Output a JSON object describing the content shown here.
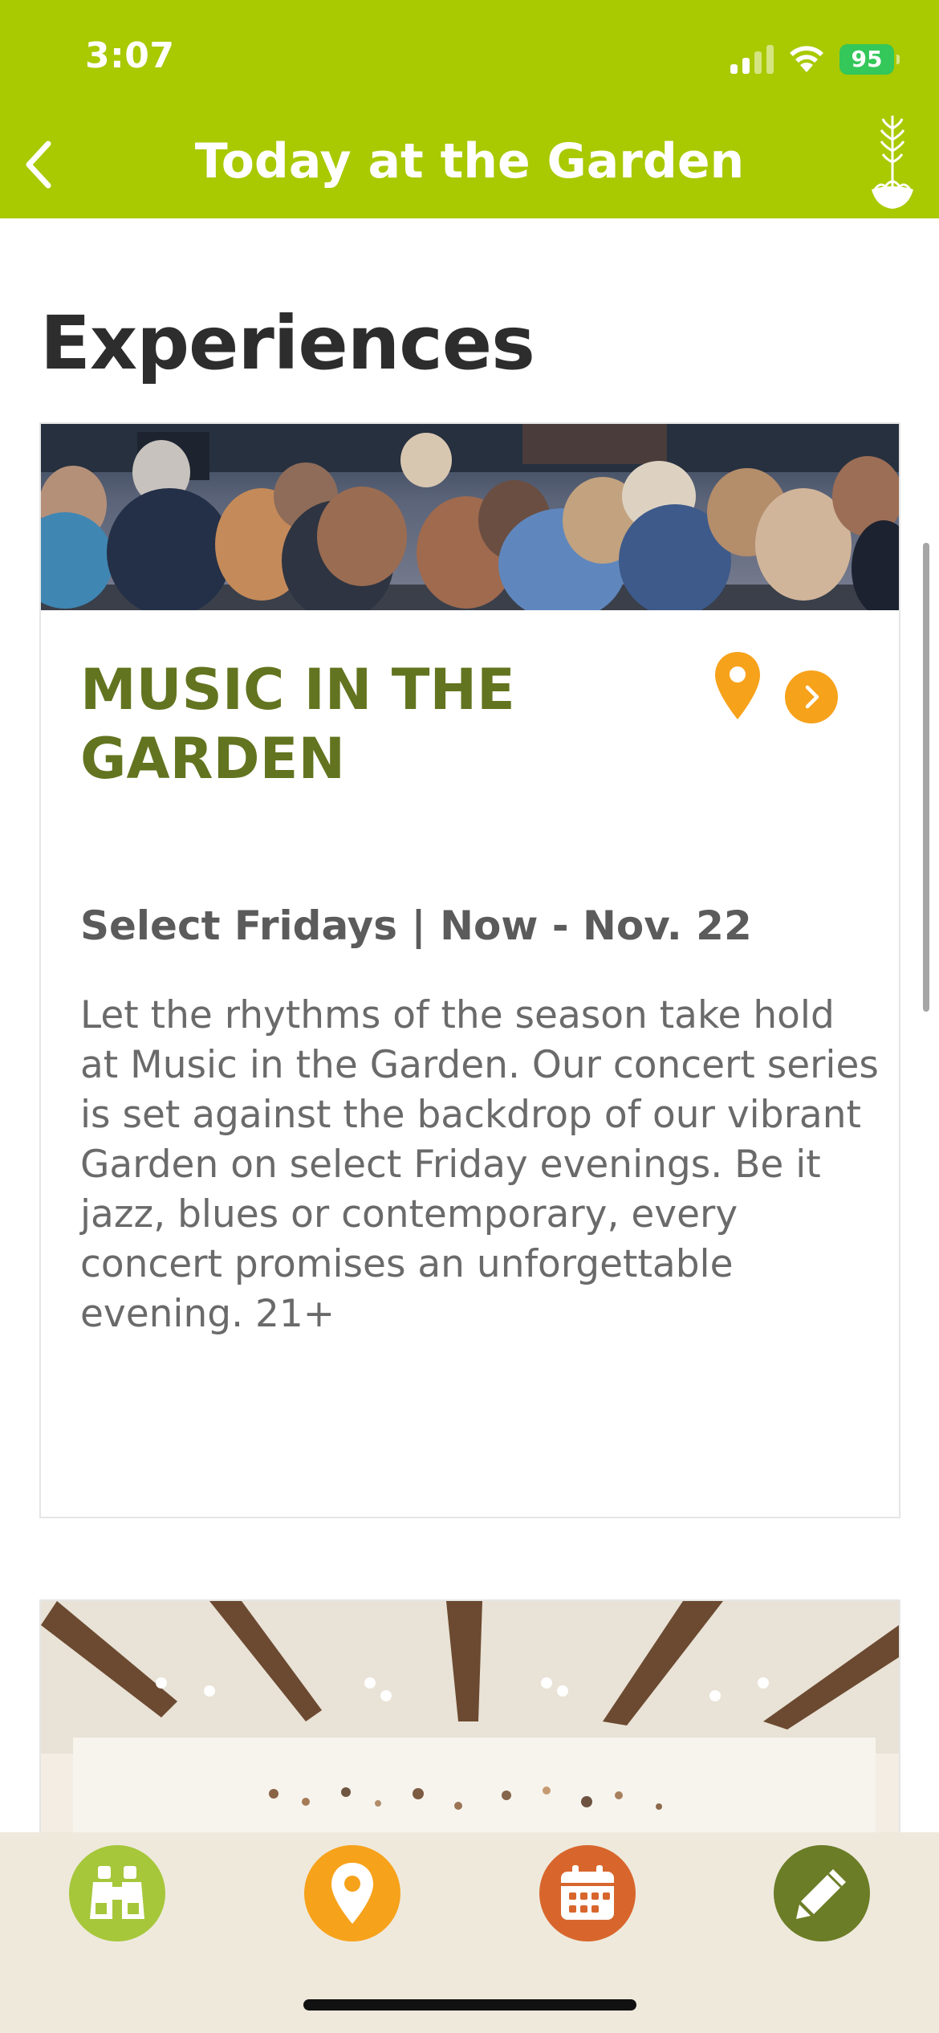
{
  "status_bar": {
    "time": "3:07",
    "battery": "95"
  },
  "header": {
    "title": "Today at the Garden"
  },
  "section": {
    "title": "Experiences"
  },
  "cards": [
    {
      "title": "MUSIC IN THE GARDEN",
      "date": "Select Fridays | Now - Nov. 22",
      "description": "Let the rhythms of the season take hold at Music in the Garden. Our concert series is set against the backdrop of our vibrant Garden on select Friday evenings. Be it jazz, blues or contemporary, every concert promises an unforgettable evening. 21+"
    }
  ],
  "tabbar": {
    "items": [
      {
        "icon": "binoculars-icon"
      },
      {
        "icon": "map-pin-icon"
      },
      {
        "icon": "calendar-icon"
      },
      {
        "icon": "pencil-icon"
      }
    ]
  },
  "colors": {
    "header_bg": "#a9c900",
    "card_title": "#62741f",
    "accent_orange": "#f7a21b",
    "tab_explore": "#a6c73a",
    "tab_map": "#f7a21b",
    "tab_calendar": "#d8662c",
    "tab_edit": "#6b7d26",
    "tabbar_bg": "#efe9dc"
  }
}
